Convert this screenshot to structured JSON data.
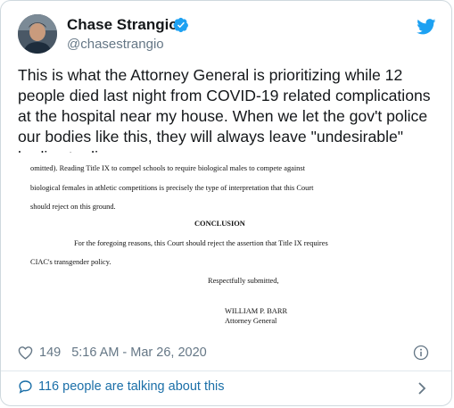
{
  "author": {
    "name": "Chase Strangio",
    "handle": "@chasestrangio",
    "verified": true
  },
  "tweet": {
    "text": "This is what the Attorney General is prioritizing while 12 people died last night from COVID-19 related complications at the hospital near my house. When we let the gov't police our bodies like this, they will always leave \"undesirable\" bodies to die."
  },
  "document": {
    "line1": "omitted).  Reading Title IX to compel schools to require biological males to compete against",
    "line2": "biological females in athletic competitions is precisely the type of interpretation that this Court",
    "line3": "should reject on this ground.",
    "heading": "CONCLUSION",
    "line4": "For the foregoing reasons, this Court should reject the assertion that Title IX requires",
    "line5": "CIAC's transgender policy.",
    "closing": "Respectfully submitted,",
    "signer_name": "WILLIAM P. BARR",
    "signer_title": "Attorney General"
  },
  "meta": {
    "likes": "149",
    "timestamp": "5:16 AM - Mar 26, 2020"
  },
  "footer": {
    "talking": "116 people are talking about this"
  },
  "icons": {
    "verified": "verified-badge-icon",
    "brand": "twitter-bird-icon",
    "like": "heart-icon",
    "info": "info-icon",
    "reply": "speech-bubble-icon",
    "chevron": "chevron-right-icon"
  },
  "colors": {
    "brand_blue": "#1da1f2",
    "link_blue": "#1b6fa8",
    "muted_text": "#657786",
    "primary_text": "#14171a"
  }
}
